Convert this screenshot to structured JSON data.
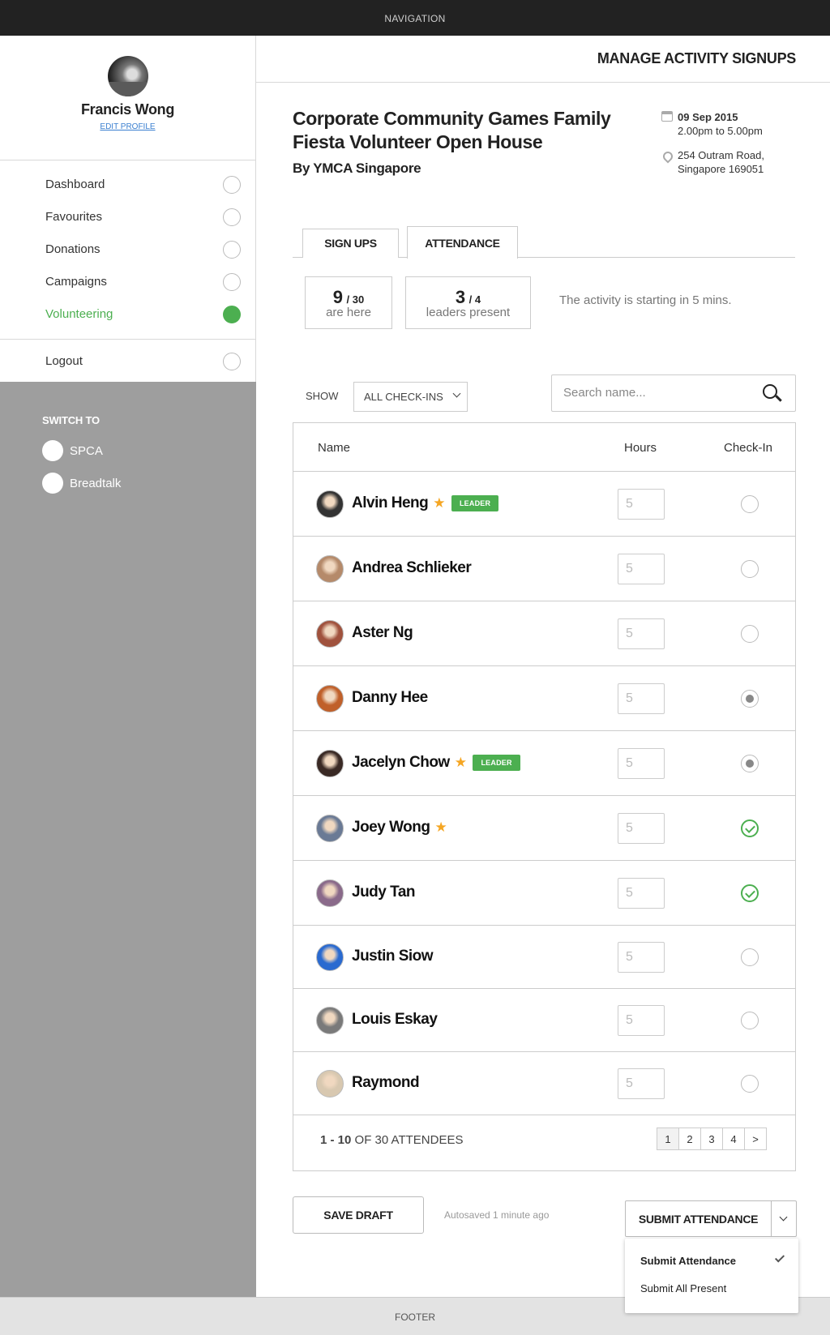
{
  "navigation": {
    "label": "NAVIGATION"
  },
  "profile": {
    "name": "Francis Wong",
    "edit_label": "EDIT PROFILE"
  },
  "menu": [
    {
      "label": "Dashboard",
      "active": false
    },
    {
      "label": "Favourites",
      "active": false
    },
    {
      "label": "Donations",
      "active": false
    },
    {
      "label": "Campaigns",
      "active": false
    },
    {
      "label": "Volunteering",
      "active": true
    }
  ],
  "logout_label": "Logout",
  "switch": {
    "title": "SWITCH TO",
    "items": [
      "SPCA",
      "Breadtalk"
    ]
  },
  "header": {
    "title": "MANAGE ACTIVITY SIGNUPS"
  },
  "event": {
    "title": "Corporate Community Games Family Fiesta Volunteer Open House",
    "org": "By YMCA Singapore",
    "date": "09 Sep 2015",
    "time": "2.00pm to 5.00pm",
    "address_line1": "254 Outram Road,",
    "address_line2": "Singapore 169051"
  },
  "tabs": [
    "SIGN UPS",
    "ATTENDANCE"
  ],
  "stats": {
    "here": {
      "count": "9",
      "total": "/ 30",
      "label": "are here"
    },
    "leaders": {
      "count": "3",
      "total": "/ 4",
      "label": "leaders present"
    },
    "status": "The activity is starting in 5 mins."
  },
  "filter": {
    "show_label": "SHOW",
    "selected": "ALL CHECK-INS"
  },
  "search": {
    "placeholder": "Search name..."
  },
  "table": {
    "headers": {
      "name": "Name",
      "hours": "Hours",
      "checkin": "Check-In"
    },
    "rows": [
      {
        "name": "Alvin Heng",
        "star": true,
        "leader": true,
        "hours": "5",
        "checkin": "none",
        "avatar_color": "#333333"
      },
      {
        "name": "Andrea Schlieker",
        "star": false,
        "leader": false,
        "hours": "5",
        "checkin": "none",
        "avatar_color": "#b58a6a"
      },
      {
        "name": "Aster Ng",
        "star": false,
        "leader": false,
        "hours": "5",
        "checkin": "none",
        "avatar_color": "#a0523d"
      },
      {
        "name": "Danny Hee",
        "star": false,
        "leader": false,
        "hours": "5",
        "checkin": "partial",
        "avatar_color": "#c0602a"
      },
      {
        "name": "Jacelyn Chow",
        "star": true,
        "leader": true,
        "hours": "5",
        "checkin": "partial",
        "avatar_color": "#3a2a25"
      },
      {
        "name": "Joey Wong",
        "star": true,
        "leader": false,
        "hours": "5",
        "checkin": "done",
        "avatar_color": "#6a7a95"
      },
      {
        "name": "Judy Tan",
        "star": false,
        "leader": false,
        "hours": "5",
        "checkin": "done",
        "avatar_color": "#8a6a8a"
      },
      {
        "name": "Justin Siow",
        "star": false,
        "leader": false,
        "hours": "5",
        "checkin": "none",
        "avatar_color": "#2a6ad0"
      },
      {
        "name": "Louis Eskay",
        "star": false,
        "leader": false,
        "hours": "5",
        "checkin": "none",
        "avatar_color": "#7a7a7a"
      },
      {
        "name": "Raymond",
        "star": false,
        "leader": false,
        "hours": "5",
        "checkin": "none",
        "avatar_color": "#d8c8b0"
      }
    ],
    "leader_badge": "LEADER",
    "range_prefix": "1 - 10",
    "range_suffix": "OF  30  ATTENDEES",
    "pages": [
      "1",
      "2",
      "3",
      "4",
      ">"
    ]
  },
  "actions": {
    "save_draft": "SAVE DRAFT",
    "autosave": "Autosaved 1 minute ago",
    "submit": "SUBMIT ATTENDANCE",
    "dropdown": [
      "Submit Attendance",
      "Submit All Present"
    ]
  },
  "footer": {
    "label": "FOOTER"
  },
  "colors": {
    "accent_green": "#4caf50",
    "star": "#f5a623",
    "nav_bg": "#222222",
    "switch_bg": "#9e9e9e"
  }
}
